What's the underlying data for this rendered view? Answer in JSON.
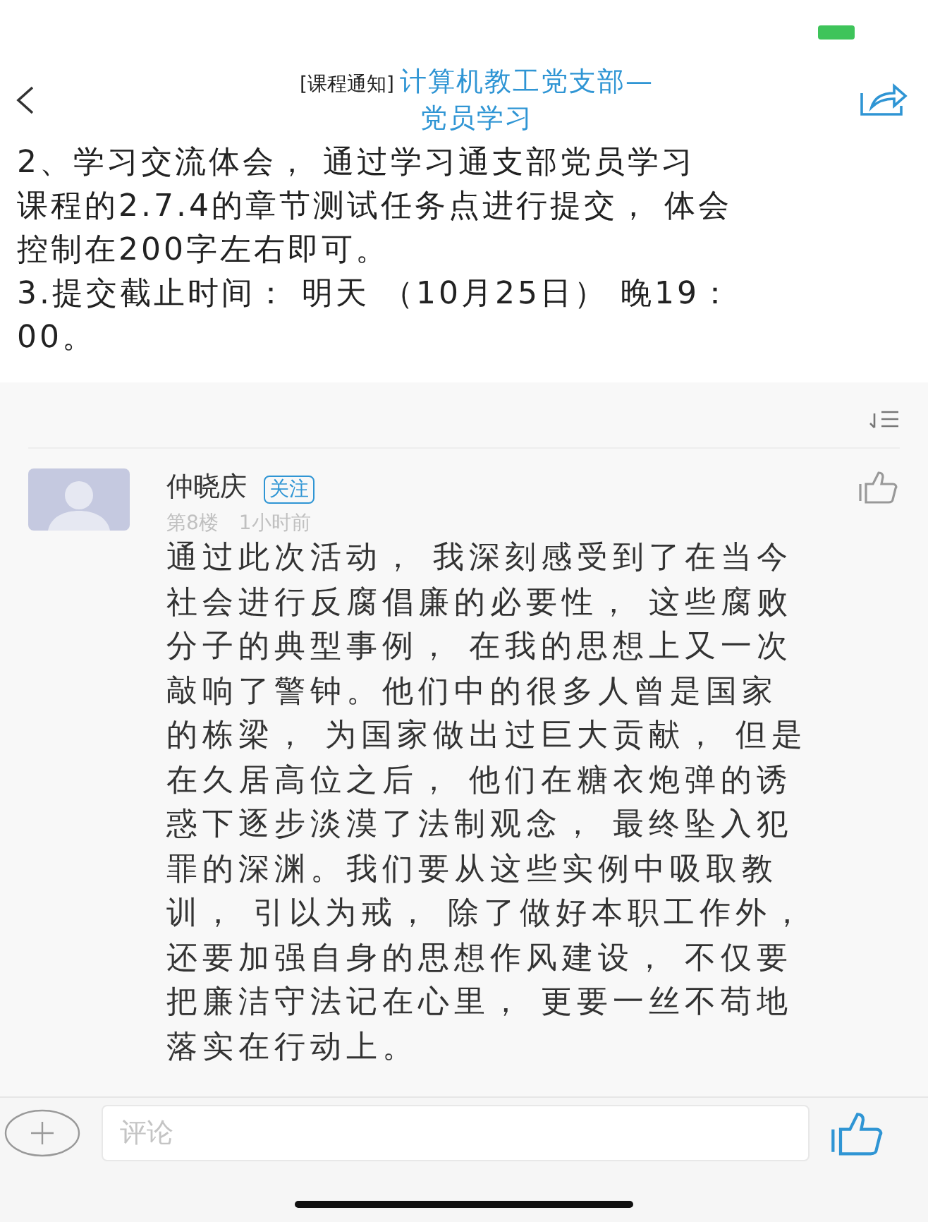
{
  "header": {
    "tag": "[课程通知]",
    "title_lines": [
      "计算机教工党支部—",
      "党员学习"
    ]
  },
  "article": {
    "lines": [
      "2、学习交流体会， 通过学习通支部党员学习",
      "课程的2.7.4的章节测试任务点进行提交， 体会",
      "控制在200字左右即可。",
      "3.提交截止时间： 明天 （10月25日） 晚19：",
      "00。"
    ]
  },
  "comments": [
    {
      "author": "仲晓庆",
      "follow": "关注",
      "floor": "第8楼",
      "time": "1小时前",
      "liked": false,
      "body_lines": [
        "通过此次活动， 我深刻感受到了在当今",
        "社会进行反腐倡廉的必要性， 这些腐败",
        "分子的典型事例， 在我的思想上又一次",
        "敲响了警钟。他们中的很多人曾是国家",
        "的栋梁， 为国家做出过巨大贡献， 但是",
        "在久居高位之后， 他们在糖衣炮弹的诱",
        "惑下逐步淡漠了法制观念， 最终坠入犯",
        "罪的深渊。我们要从这些实例中吸取教",
        "训， 引以为戒， 除了做好本职工作外，",
        "还要加强自身的思想作风建设， 不仅要",
        "把廉洁守法记在心里， 更要一丝不苟地",
        "落实在行动上。"
      ]
    }
  ],
  "comment_bar": {
    "placeholder": "评论",
    "liked": false
  }
}
